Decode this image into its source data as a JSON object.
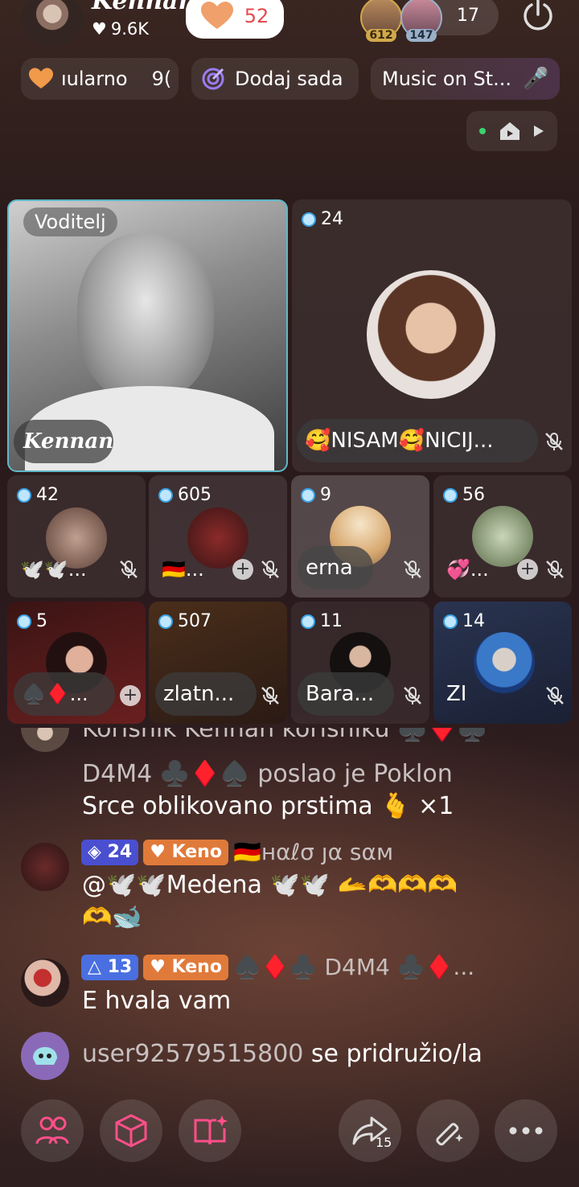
{
  "header": {
    "host_name": "Kennan",
    "host_likes": "9.6K",
    "heart_count": "52",
    "top_viewer_1": "612",
    "top_viewer_2": "147",
    "viewer_count": "17"
  },
  "pills": {
    "popular": "ıularno",
    "popular_num": "9(",
    "add_now": "Dodaj sada",
    "music": "Music on St..."
  },
  "host_tile": {
    "label": "Voditelj",
    "name": "Kennan"
  },
  "guests": [
    {
      "count": "24",
      "name": "🥰NISAM🥰NICIJ..."
    },
    {
      "count": "42",
      "name": "🕊️🕊️..."
    },
    {
      "count": "605",
      "name": "🇩🇪..."
    },
    {
      "count": "9",
      "name": "erna"
    },
    {
      "count": "56",
      "name": "💞..."
    },
    {
      "count": "5",
      "name": "♠️♦️..."
    },
    {
      "count": "507",
      "name": "zlatn..."
    },
    {
      "count": "11",
      "name": "Bara..."
    },
    {
      "count": "14",
      "name": "ZI"
    }
  ],
  "chat": {
    "line0": "Korisnik Kennan korisniku ♣️♦️♣️",
    "line1": "D4M4 ♣️♦️♠️ poslao je Poklon",
    "line2": "Srce oblikovano prstima 🫰 ×1",
    "msg1_level": "24",
    "msg1_badge": "Keno",
    "msg1_name": "🇩🇪ʜαℓσ ȷα ѕαм",
    "msg1_text1": "@🕊️🕊️Medena 🕊️🕊️ 🫴🫶🫶🫶",
    "msg1_text2": "🫶🐋",
    "msg2_level": "13",
    "msg2_badge": "Keno",
    "msg2_name": "♠️♦️♣️ D4M4 ♣️♦️...",
    "msg2_text": "E hvala vam",
    "join_user": "user92579515800",
    "join_text": " se pridružio/la"
  },
  "bottom": {
    "share_count": "15"
  }
}
